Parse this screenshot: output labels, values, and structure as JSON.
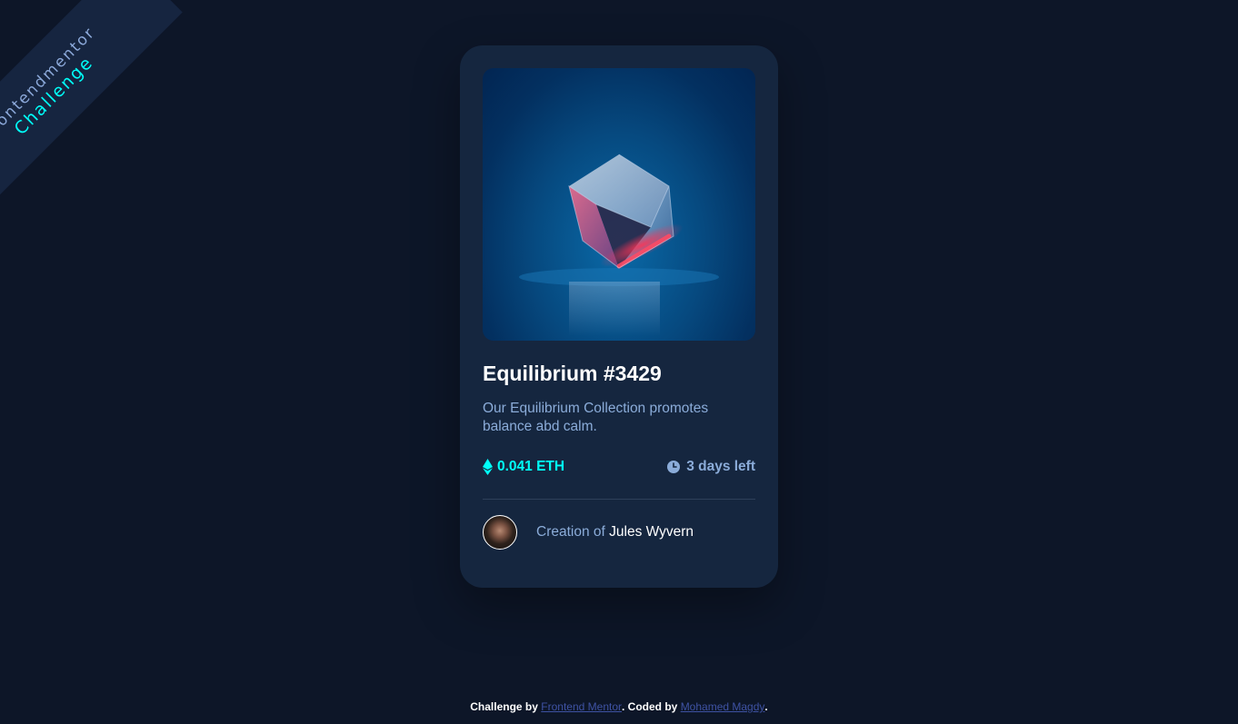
{
  "badge": {
    "line1": "frontendmentor",
    "line2": "Challenge"
  },
  "card": {
    "image_alt": "equilibrium-cube",
    "title": "Equilibrium #3429",
    "description": "Our Equilibrium Collection promotes balance abd calm.",
    "price": "0.041 ETH",
    "time_left": "3 days left",
    "creator_prefix": "Creation of",
    "creator_name": "Jules Wyvern"
  },
  "footer": {
    "prefix": "Challenge by",
    "link1": "Frontend Mentor",
    "middle": ". Coded by",
    "link2": "Mohamed Magdy",
    "suffix": "."
  },
  "colors": {
    "background": "#0d1628",
    "card": "#15263f",
    "accent": "#00fff8",
    "muted": "#8bacd9",
    "link": "#3e52a3"
  },
  "icons": [
    "ethereum-icon",
    "clock-icon"
  ]
}
